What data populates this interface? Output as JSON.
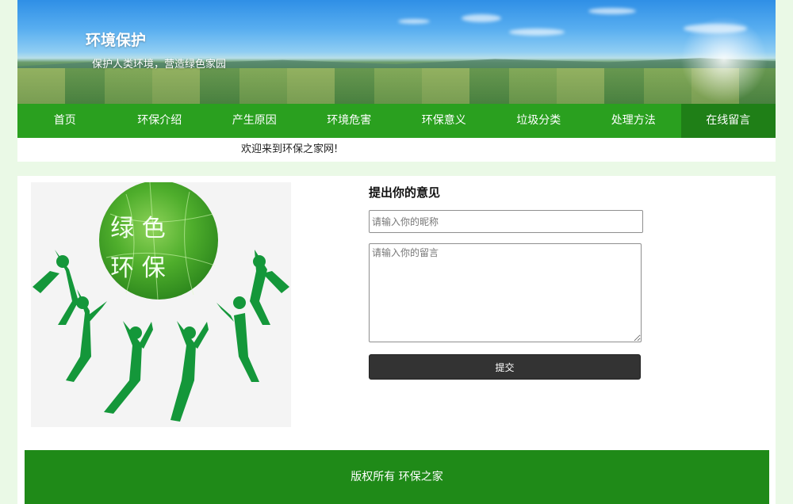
{
  "header": {
    "title": "环境保护",
    "slogan": "保护人类环境，营造绿色家园"
  },
  "nav": {
    "items": [
      {
        "label": "首页"
      },
      {
        "label": "环保介绍"
      },
      {
        "label": "产生原因"
      },
      {
        "label": "环境危害"
      },
      {
        "label": "环保意义"
      },
      {
        "label": "垃圾分类"
      },
      {
        "label": "处理方法"
      },
      {
        "label": "在线留言"
      }
    ],
    "active_index": 7
  },
  "welcome_text": "欢迎来到环保之家网!",
  "logo": {
    "line1": "绿 色",
    "line2": "环 保"
  },
  "form": {
    "title": "提出你的意见",
    "nickname_placeholder": "请输入你的昵称",
    "message_placeholder": "请输入你的留言",
    "submit_label": "提交"
  },
  "footer": {
    "text": "版权所有 环保之家"
  },
  "colors": {
    "nav_bg": "#2aa01f",
    "nav_active_bg": "#1f7f17",
    "footer_bg": "#1f8a18",
    "page_bg": "#eaf9e6",
    "logo_green": "#14973a"
  }
}
